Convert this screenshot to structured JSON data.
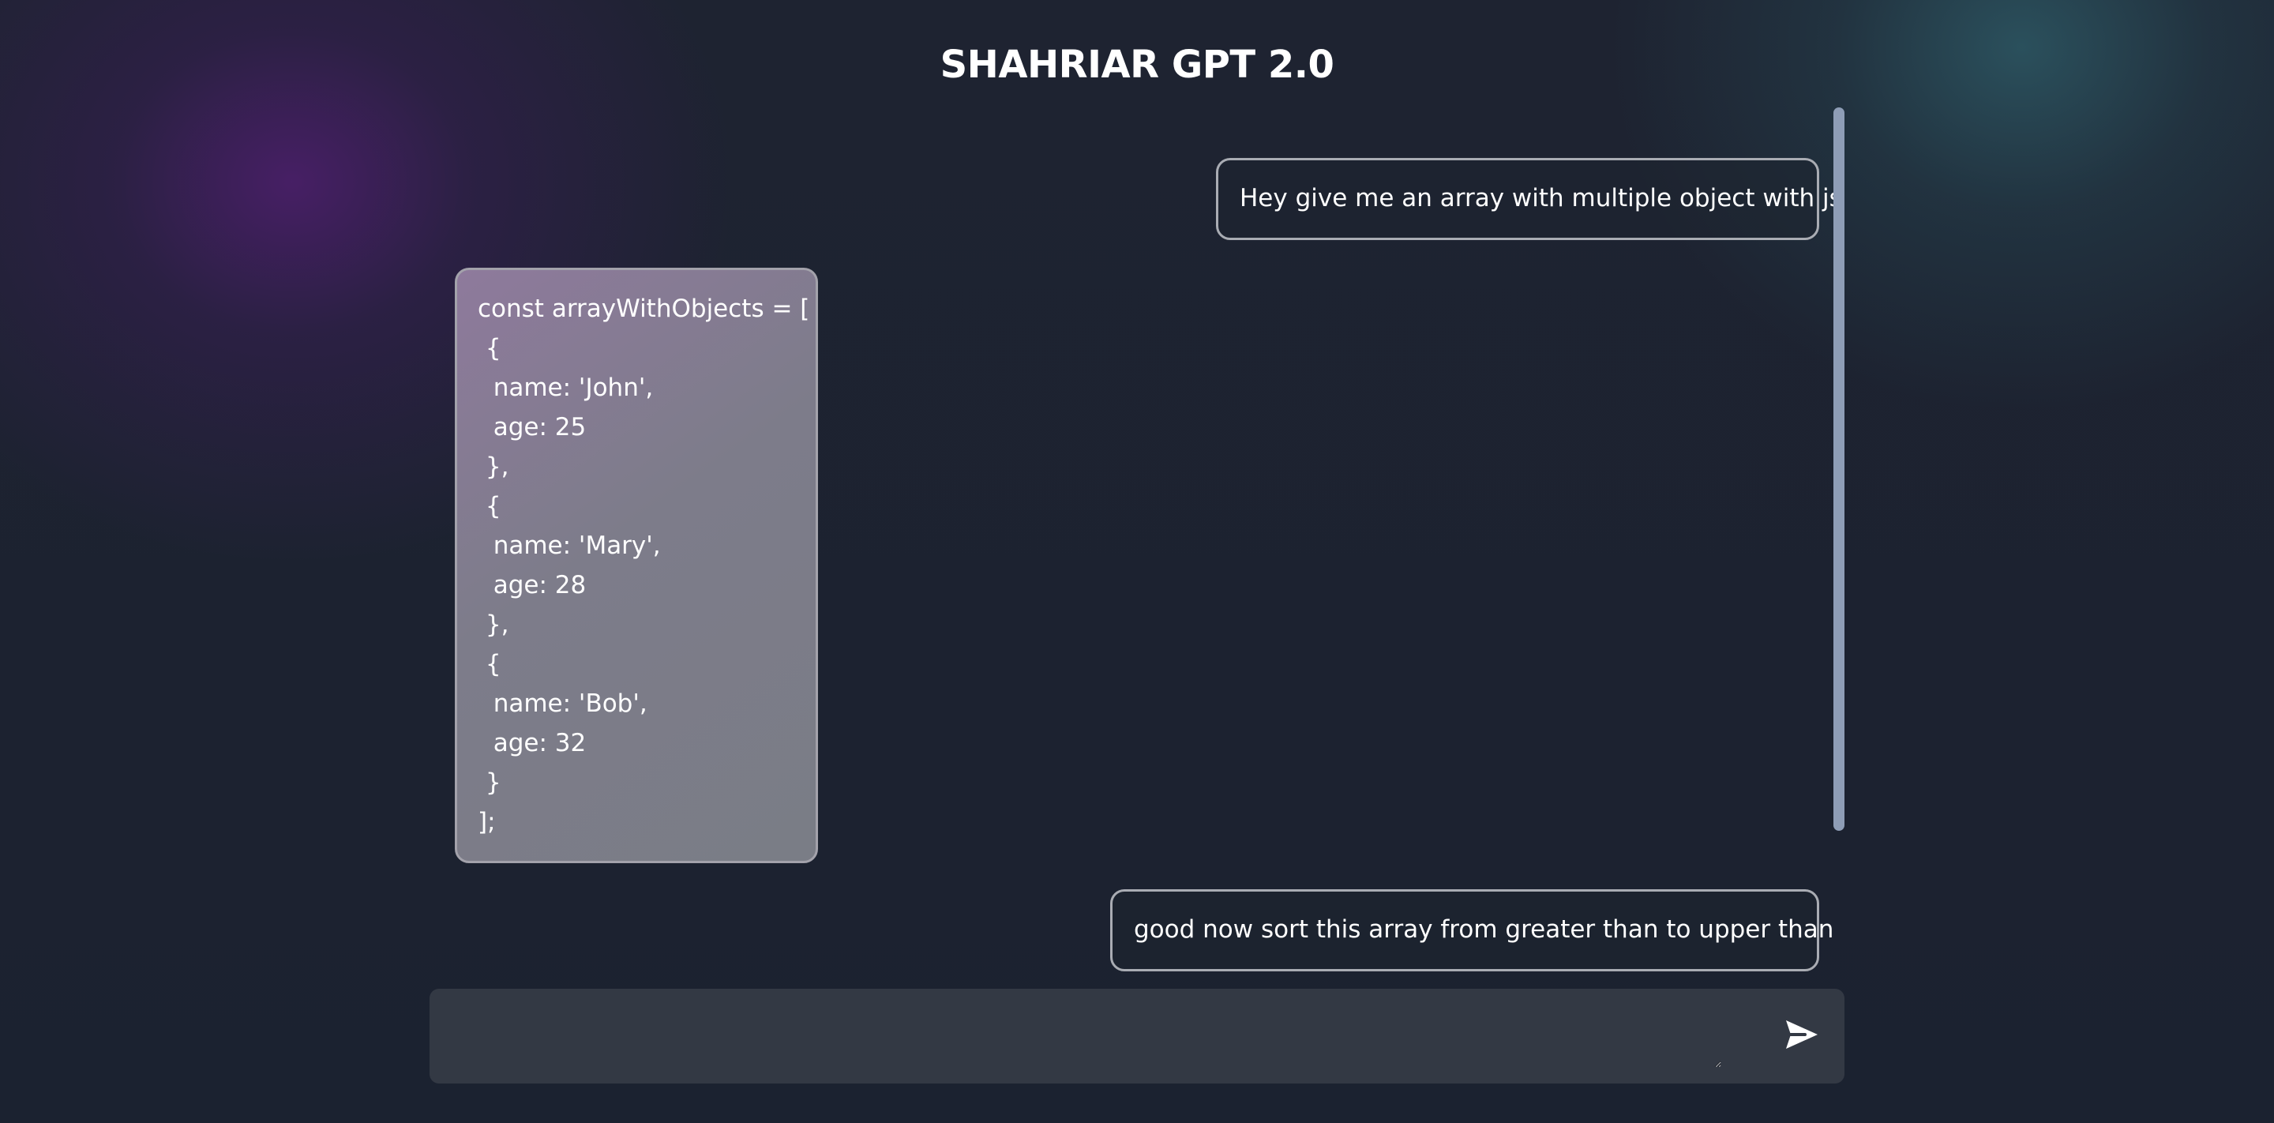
{
  "header": {
    "title": "SHAHRIAR GPT 2.0"
  },
  "messages": [
    {
      "role": "user",
      "text": "Hey give me an array with multiple object with js"
    },
    {
      "role": "assistant",
      "text": "const arrayWithObjects = [\n {\n  name: 'John',\n  age: 25\n },\n {\n  name: 'Mary',\n  age: 28\n },\n {\n  name: 'Bob',\n  age: 32\n }\n];"
    },
    {
      "role": "user",
      "text": "good now sort this array from greater than to upper than"
    }
  ],
  "composer": {
    "value": "",
    "placeholder": "",
    "send_icon": "send-icon"
  },
  "colors": {
    "background": "#1d2330",
    "composer": "#333944",
    "bubble_border": "#a9acb3",
    "scrollbar": "#8e9db6",
    "assistant_bubble": "#7d7c8a"
  }
}
